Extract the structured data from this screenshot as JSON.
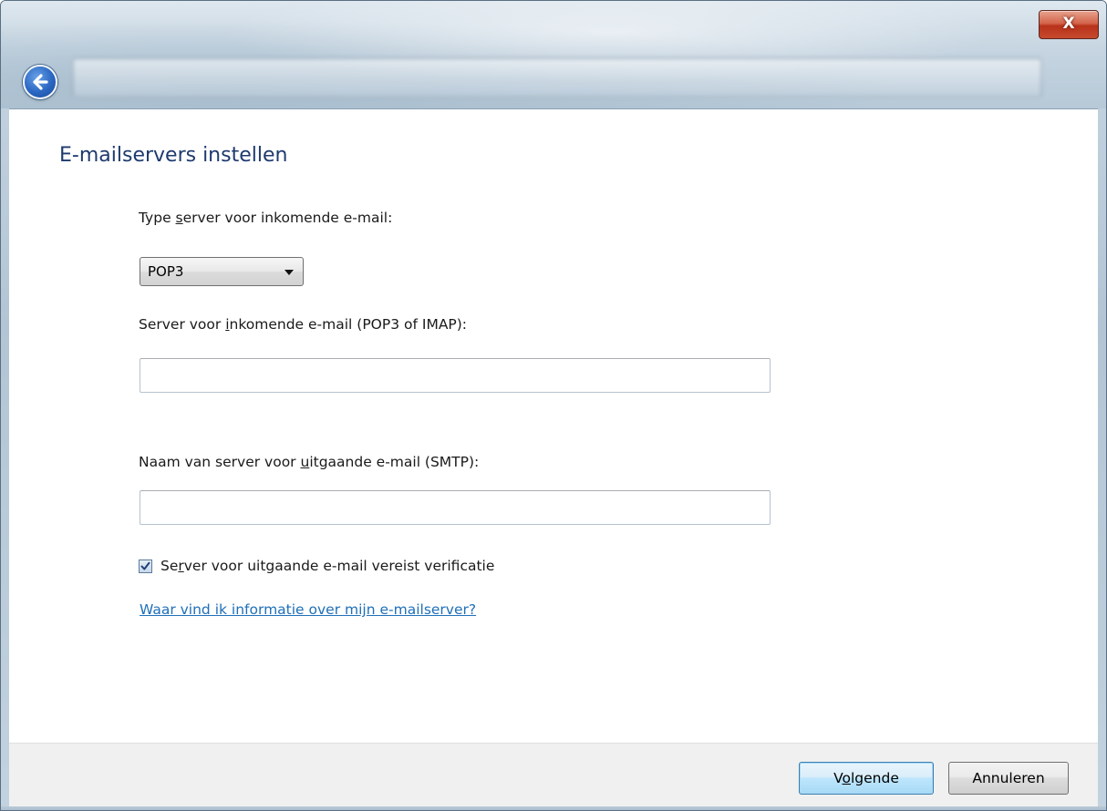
{
  "window": {
    "close_glyph": "X",
    "back_icon": "back-arrow-icon",
    "close_icon": "close-icon",
    "accent_color": "#1e3a6e",
    "link_color": "#1f6fb8"
  },
  "page": {
    "title": "E-mailservers instellen"
  },
  "incoming_type": {
    "label_pre": "Type ",
    "label_accel": "s",
    "label_post": "erver voor inkomende e-mail:",
    "selected_value": "POP3",
    "options": [
      "POP3"
    ]
  },
  "incoming_server": {
    "label_pre": "Server voor ",
    "label_accel": "i",
    "label_post": "nkomende e-mail (POP3 of IMAP):",
    "value": ""
  },
  "outgoing_server": {
    "label_pre": "Naam van server voor ",
    "label_accel": "u",
    "label_post": "itgaande e-mail (SMTP):",
    "value": ""
  },
  "auth_checkbox": {
    "checked": true,
    "label_pre": "Se",
    "label_accel": "r",
    "label_post": "ver voor uitgaande e-mail vereist verificatie"
  },
  "help_link": {
    "text": "Waar vind ik informatie over mijn e-mailserver?"
  },
  "footer": {
    "next_pre": "V",
    "next_accel": "o",
    "next_post": "lgende",
    "cancel_label": "Annuleren"
  }
}
